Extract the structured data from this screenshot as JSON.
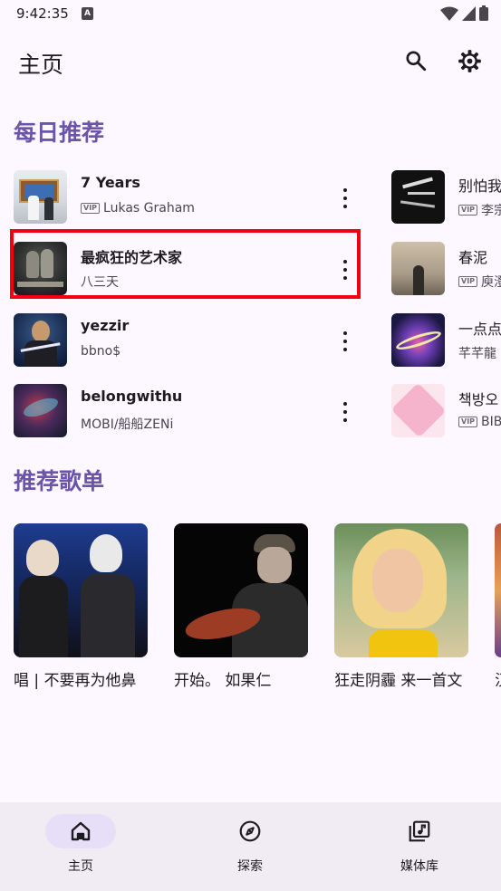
{
  "status_bar": {
    "time": "9:42:35",
    "a_badge": "A"
  },
  "header": {
    "title": "主页"
  },
  "daily": {
    "title": "每日推荐",
    "left_col": [
      {
        "title": "7 Years",
        "subtitle": "Lukas Graham",
        "vip": true
      },
      {
        "title": "最疯狂的艺术家",
        "subtitle": "八三天",
        "vip": false
      },
      {
        "title": "yezzir",
        "subtitle": "bbno$",
        "vip": false
      },
      {
        "title": "belongwithu",
        "subtitle": "MOBI/船船ZENi",
        "vip": false
      }
    ],
    "right_col": [
      {
        "title": "别怕我",
        "subtitle": "李宗",
        "vip": true
      },
      {
        "title": "春泥",
        "subtitle": "庾澄",
        "vip": true
      },
      {
        "title": "一点点",
        "subtitle": "芊芊龍",
        "vip": false
      },
      {
        "title": "책방오",
        "subtitle": "BIB",
        "vip": true
      }
    ],
    "vip_label": "VIP"
  },
  "playlists": {
    "title": "推荐歌单",
    "items": [
      {
        "label": "唱 | 不要再为他鼻"
      },
      {
        "label": "开始。          如果仁"
      },
      {
        "label": "狂走阴霾 来一首文"
      },
      {
        "label": "汉"
      }
    ]
  },
  "bottom_nav": {
    "items": [
      {
        "label": "主页",
        "icon": "home-icon",
        "active": true
      },
      {
        "label": "探索",
        "icon": "compass-icon",
        "active": false
      },
      {
        "label": "媒体库",
        "icon": "library-music-icon",
        "active": false
      }
    ]
  },
  "colors": {
    "accent": "#6a55a8",
    "highlight": "#f00012",
    "background": "#fdf7ff",
    "nav_bg": "#f1ecf4"
  }
}
